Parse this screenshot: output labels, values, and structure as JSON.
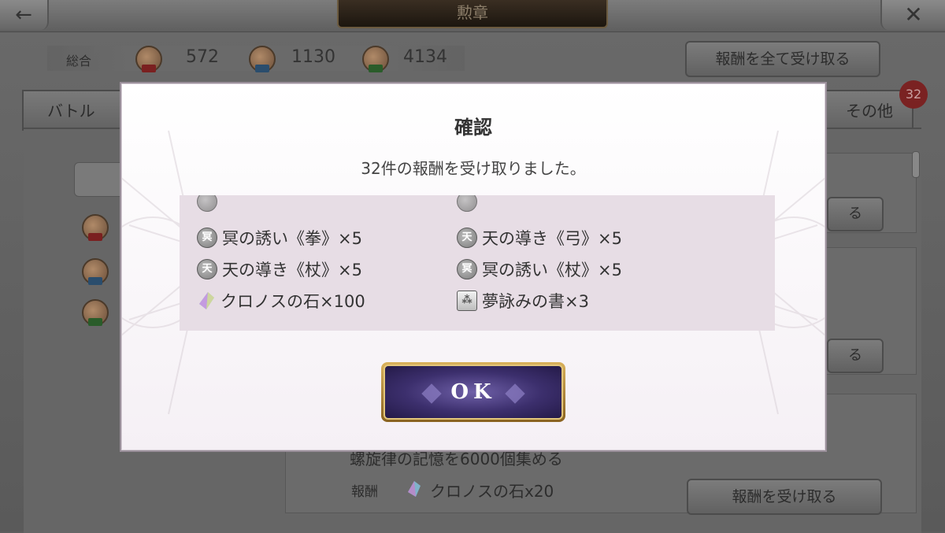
{
  "screen_title": "勲章",
  "nav": {
    "back_glyph": "←",
    "close_glyph": "✕"
  },
  "totals": {
    "label": "総合",
    "medals": [
      {
        "ribbon": "red",
        "value": "572"
      },
      {
        "ribbon": "blue",
        "value": "1130"
      },
      {
        "ribbon": "green",
        "value": "4134"
      }
    ]
  },
  "receive_all_label": "報酬を全て受け取る",
  "tabs": {
    "battle": "バトル",
    "other": "その他",
    "other_badge": "32"
  },
  "background_rows": {
    "button_suffix": "る",
    "mission_text": "螺旋律の記憶を6000個集める",
    "reward_label": "報酬",
    "reward_value": "クロノスの石x20",
    "receive_label": "報酬を受け取る"
  },
  "dialog": {
    "title": "確認",
    "message": "32件の報酬を受け取りました。",
    "items": [
      {
        "icon": "meikai-icon",
        "glyph": "冥",
        "text": "冥の誘い《拳》×5"
      },
      {
        "icon": "ten-icon",
        "glyph": "天",
        "text": "天の導き《弓》×5"
      },
      {
        "icon": "ten-icon",
        "glyph": "天",
        "text": "天の導き《杖》×5"
      },
      {
        "icon": "meikai-icon",
        "glyph": "冥",
        "text": "冥の誘い《杖》×5"
      },
      {
        "icon": "crystal-icon",
        "glyph": "",
        "text": "クロノスの石×100"
      },
      {
        "icon": "book-icon",
        "glyph": "⁂",
        "text": "夢詠みの書×3"
      }
    ],
    "ok_label": "OK"
  },
  "colors": {
    "dialog_bg": "#ffffff",
    "list_bg": "#e7dde5",
    "ok_button": "#3c2f6d",
    "ok_border": "#d9b15b",
    "badge": "#7a2222"
  }
}
